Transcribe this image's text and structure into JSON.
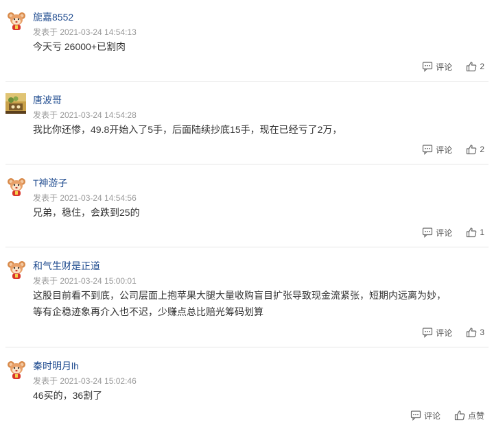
{
  "labels": {
    "reply": "评论",
    "like": "点赞"
  },
  "comments": [
    {
      "avatar": "cartoon-avatar-icon",
      "username": "旎嘉8552",
      "time": "发表于 2021-03-24 14:54:13",
      "lines": [
        "今天亏 26000+已割肉"
      ],
      "likes": "2"
    },
    {
      "avatar": "photo-avatar",
      "username": "唐波哥",
      "time": "发表于 2021-03-24 14:54:28",
      "lines": [
        "我比你还惨，49.8开始入了5手，后面陆续抄底15手，现在已经亏了2万，"
      ],
      "likes": "2"
    },
    {
      "avatar": "cartoon-avatar-icon",
      "username": "T神游子",
      "time": "发表于 2021-03-24 14:54:56",
      "lines": [
        "兄弟，稳住，会跌到25的"
      ],
      "likes": "1"
    },
    {
      "avatar": "cartoon-avatar-icon",
      "username": "和气生财是正道",
      "time": "发表于 2021-03-24 15:00:01",
      "lines": [
        "这股目前看不到底，公司层面上抱苹果大腿大量收购盲目扩张导致现金流紧张，短期内远离为妙，",
        "等有企稳迹象再介入也不迟，少赚点总比赔光筹码划算"
      ],
      "likes": "3"
    },
    {
      "avatar": "cartoon-avatar-icon",
      "username": "秦时明月lh",
      "time": "发表于 2021-03-24 15:02:46",
      "lines": [
        "46买的，36割了"
      ],
      "likes": ""
    }
  ]
}
